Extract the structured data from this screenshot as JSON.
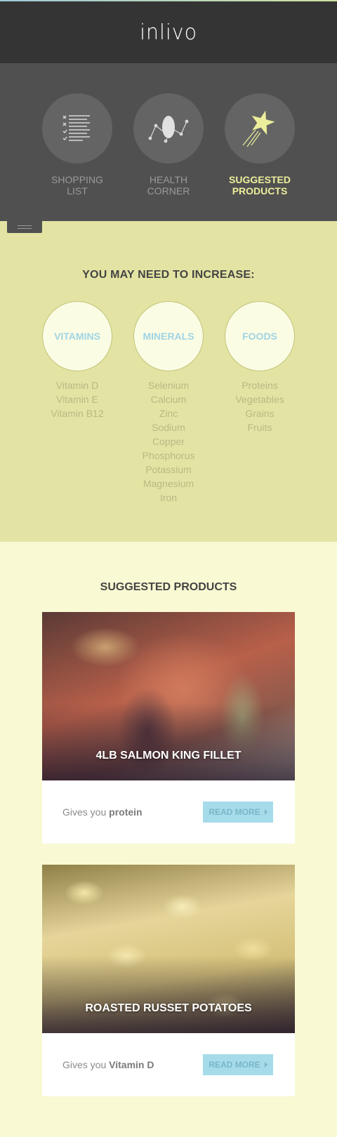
{
  "header": {
    "logo": "inlivo"
  },
  "nav": {
    "items": [
      {
        "label": "SHOPPING\nLIST",
        "icon": "checklist-icon",
        "active": false
      },
      {
        "label": "HEALTH\nCORNER",
        "icon": "molecule-icon",
        "active": false
      },
      {
        "label": "SUGGESTED\nPRODUCTS",
        "icon": "shooting-star-icon",
        "active": true
      }
    ],
    "menu_icon": "hamburger-icon"
  },
  "increase": {
    "title_prefix": "YOU MAY NEED TO ",
    "title_bold": "INCREASE:",
    "groups": [
      {
        "name": "VITAMINS",
        "items": [
          "Vitamin D",
          "Vitamin E",
          "Vitamin B12"
        ]
      },
      {
        "name": "MINERALS",
        "items": [
          "Selenium",
          "Calcium",
          "Zinc",
          "Sodium",
          "Copper",
          "Phosphorus",
          "Potassium",
          "Magnesium",
          "Iron"
        ]
      },
      {
        "name": "FOODS",
        "items": [
          "Proteins",
          "Vegetables",
          "Grains",
          "Fruits"
        ]
      }
    ]
  },
  "products": {
    "title_bold": "SUGGESTED",
    "title_rest": " PRODUCTS",
    "cards": [
      {
        "title": "4LB SALMON KING FILLET",
        "gives_prefix": "Gives you ",
        "gives_bold": "protein",
        "button": "READ MORE"
      },
      {
        "title": "ROASTED RUSSET POTATOES",
        "gives_prefix": "Gives you ",
        "gives_bold": "Vitamin D",
        "button": "READ MORE"
      }
    ]
  },
  "colors": {
    "header_bg": "#343434",
    "nav_bg": "#505050",
    "active_accent": "#ecee9c",
    "increase_bg": "#e3e4a3",
    "products_bg": "#f9f9d3",
    "circle_label": "#9fd4e4",
    "button_bg": "#a6dbea"
  }
}
